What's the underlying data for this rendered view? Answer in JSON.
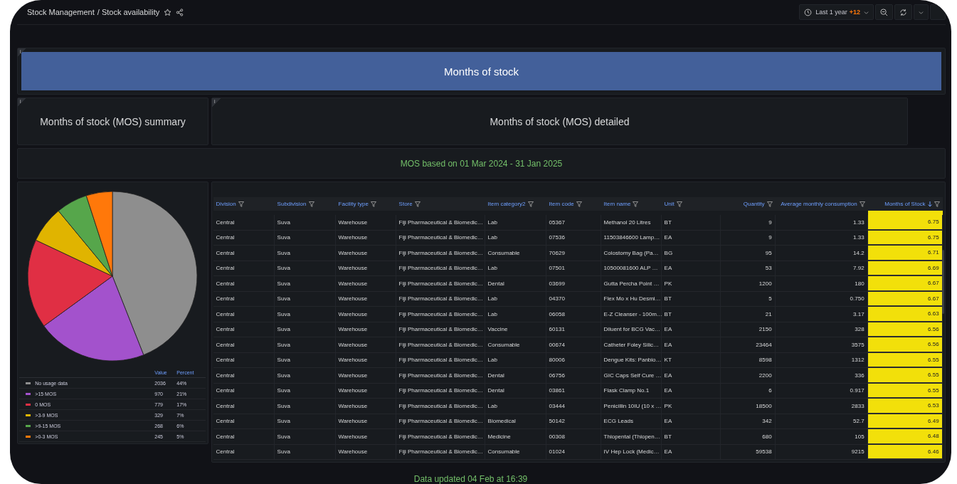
{
  "top_bar": {
    "breadcrumb": [
      {
        "label": "Stock Management"
      },
      {
        "label": "/ Stock availability"
      }
    ],
    "time_picker": {
      "label": "Last 1 year",
      "offset": "+12"
    }
  },
  "banner": {
    "info": "i",
    "title": "Months of stock"
  },
  "section_headers": [
    {
      "info": "i",
      "title": "Months of stock (MOS) summary"
    },
    {
      "info": "i",
      "title": "Months of stock (MOS) detailed"
    }
  ],
  "period_note": "MOS based on 01 Mar 2024 - 31 Jan 2025",
  "summary": {
    "chart_data": {
      "type": "pie",
      "categories": [
        "No usage data",
        ">15 MOS",
        "0 MOS",
        ">3-9 MOS",
        ">9-15 MOS",
        ">0-3 MOS"
      ],
      "values": [
        44,
        21,
        17,
        7,
        6,
        5
      ]
    },
    "legend": {
      "columns": [
        "Value",
        "Percent"
      ],
      "rows": [
        {
          "color": "#8e8e8e",
          "value": "2036",
          "percent": "44%"
        },
        {
          "color": "#a352cc",
          "value": "970",
          "percent": "21%"
        },
        {
          "color": "#e02f44",
          "value": "779",
          "percent": "17%"
        },
        {
          "color": "#e0b400",
          "value": "329",
          "percent": "7%"
        },
        {
          "color": "#56a64b",
          "value": "268",
          "percent": "6%"
        },
        {
          "color": "#ff780a",
          "value": "245",
          "percent": "5%"
        }
      ]
    }
  },
  "table": {
    "columns": [
      {
        "label": "Division",
        "kind": "text",
        "sorted": false,
        "highlight": false
      },
      {
        "label": "Subdivision",
        "kind": "text",
        "sorted": false,
        "highlight": false
      },
      {
        "label": "Facility type",
        "kind": "text",
        "sorted": false,
        "highlight": false
      },
      {
        "label": "Store",
        "kind": "text",
        "sorted": false,
        "highlight": false
      },
      {
        "label": "Item category2",
        "kind": "text",
        "sorted": false,
        "highlight": false
      },
      {
        "label": "Item code",
        "kind": "text",
        "sorted": false,
        "highlight": false
      },
      {
        "label": "Item name",
        "kind": "text",
        "sorted": false,
        "highlight": false
      },
      {
        "label": "Unit",
        "kind": "text",
        "sorted": false,
        "highlight": false
      },
      {
        "label": "Quantity",
        "kind": "number",
        "sorted": false,
        "highlight": false
      },
      {
        "label": "Average monthly consumption",
        "kind": "number",
        "sorted": false,
        "highlight": false
      },
      {
        "label": "Months of Stock",
        "kind": "number",
        "sorted": true,
        "highlight": true
      }
    ],
    "rows": [
      [
        "Central",
        "Suva",
        "Warehouse",
        "Fiji Pharmaceutical & Biomedic…",
        "Lab",
        "05367",
        "Methanol 20 Litres",
        "BT",
        "9",
        "1.33",
        "6.75"
      ],
      [
        "Central",
        "Suva",
        "Warehouse",
        "Fiji Pharmaceutical & Biomedic…",
        "Lab",
        "07536",
        "11503846600 Lamp…",
        "EA",
        "9",
        "1.33",
        "6.75"
      ],
      [
        "Central",
        "Suva",
        "Warehouse",
        "Fiji Pharmaceutical & Biomedic…",
        "Consumable",
        "70629",
        "Colostomy Bag (Pa…",
        "BG",
        "95",
        "14.2",
        "6.71"
      ],
      [
        "Central",
        "Suva",
        "Warehouse",
        "Fiji Pharmaceutical & Biomedic…",
        "Lab",
        "07501",
        "10500081600 ALP …",
        "EA",
        "53",
        "7.92",
        "6.69"
      ],
      [
        "Central",
        "Suva",
        "Warehouse",
        "Fiji Pharmaceutical & Biomedic…",
        "Dental",
        "03699",
        "Gutta Percha Point …",
        "PK",
        "1200",
        "180",
        "6.67"
      ],
      [
        "Central",
        "Suva",
        "Warehouse",
        "Fiji Pharmaceutical & Biomedic…",
        "Lab",
        "04370",
        "Flex Mo x Hu Desmi…",
        "BT",
        "5",
        "0.750",
        "6.67"
      ],
      [
        "Central",
        "Suva",
        "Warehouse",
        "Fiji Pharmaceutical & Biomedic…",
        "Lab",
        "06058",
        "E-Z Cleanser - 100m…",
        "BT",
        "21",
        "3.17",
        "6.63"
      ],
      [
        "Central",
        "Suva",
        "Warehouse",
        "Fiji Pharmaceutical & Biomedic…",
        "Vaccine",
        "60131",
        "Diluent for BCG Vac…",
        "EA",
        "2150",
        "328",
        "6.56"
      ],
      [
        "Central",
        "Suva",
        "Warehouse",
        "Fiji Pharmaceutical & Biomedic…",
        "Consumable",
        "00674",
        "Catheter Foley Silic…",
        "EA",
        "23464",
        "3575",
        "6.56"
      ],
      [
        "Central",
        "Suva",
        "Warehouse",
        "Fiji Pharmaceutical & Biomedic…",
        "Lab",
        "80006",
        "Dengue Kits: Panbio…",
        "KT",
        "8598",
        "1312",
        "6.55"
      ],
      [
        "Central",
        "Suva",
        "Warehouse",
        "Fiji Pharmaceutical & Biomedic…",
        "Dental",
        "06756",
        "GIC Caps Self Cure …",
        "EA",
        "2200",
        "336",
        "6.55"
      ],
      [
        "Central",
        "Suva",
        "Warehouse",
        "Fiji Pharmaceutical & Biomedic…",
        "Dental",
        "03861",
        "Flask Clamp No.1",
        "EA",
        "6",
        "0.917",
        "6.55"
      ],
      [
        "Central",
        "Suva",
        "Warehouse",
        "Fiji Pharmaceutical & Biomedic…",
        "Lab",
        "03444",
        "Penicillin 10IU (10 x …",
        "PK",
        "18500",
        "2833",
        "6.53"
      ],
      [
        "Central",
        "Suva",
        "Warehouse",
        "Fiji Pharmaceutical & Biomedic…",
        "Biomedical",
        "50142",
        "ECG Leads",
        "EA",
        "342",
        "52.7",
        "6.49"
      ],
      [
        "Central",
        "Suva",
        "Warehouse",
        "Fiji Pharmaceutical & Biomedic…",
        "Medicine",
        "00308",
        "Thiopental (Thiopen…",
        "BT",
        "680",
        "105",
        "6.48"
      ],
      [
        "Central",
        "Suva",
        "Warehouse",
        "Fiji Pharmaceutical & Biomedic…",
        "Consumable",
        "01024",
        "IV Hep Lock (Medic…",
        "EA",
        "59538",
        "9215",
        "6.46"
      ]
    ]
  },
  "footer": "Data updated 04 Feb at 16:39"
}
